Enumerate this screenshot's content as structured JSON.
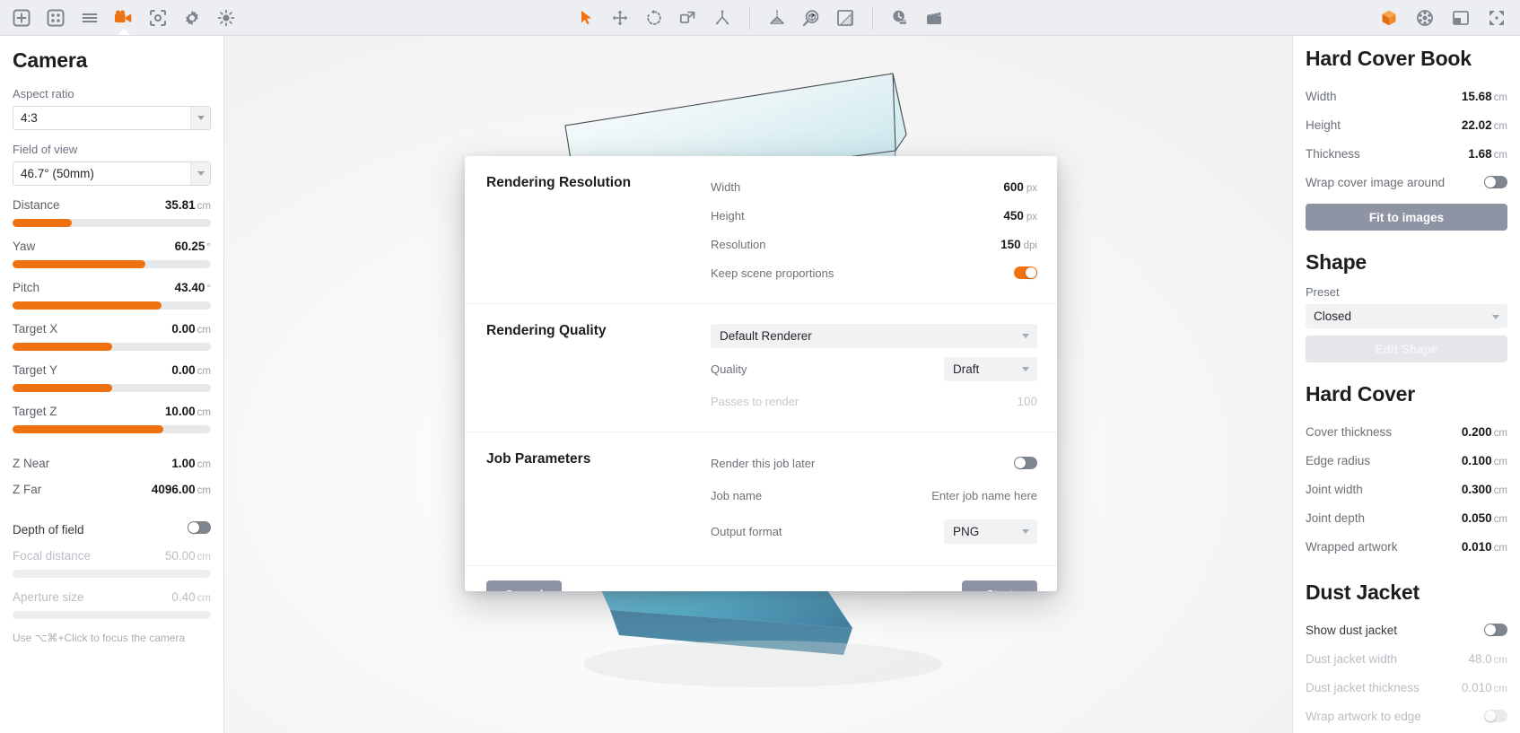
{
  "toolbar": {
    "left_icons": [
      {
        "name": "add-icon",
        "label": "Add"
      },
      {
        "name": "grid-icon",
        "label": "Layouts"
      },
      {
        "name": "list-icon",
        "label": "List"
      },
      {
        "name": "camera-icon",
        "label": "Camera"
      },
      {
        "name": "snapshot-icon",
        "label": "Snapshot"
      },
      {
        "name": "settings-gear-icon",
        "label": "Settings"
      },
      {
        "name": "light-bulb-icon",
        "label": "Lighting"
      }
    ],
    "center_icons": [
      {
        "name": "select-cursor-icon",
        "label": "Select"
      },
      {
        "name": "move-icon",
        "label": "Move"
      },
      {
        "name": "rotate-icon",
        "label": "Rotate"
      },
      {
        "name": "scale-icon",
        "label": "Scale"
      },
      {
        "name": "distribute-icon",
        "label": "Distribute"
      },
      {
        "name": "perspective-icon",
        "label": "Perspective"
      },
      {
        "name": "inspect-object-icon",
        "label": "Inspect"
      },
      {
        "name": "shading-icon",
        "label": "Shading"
      },
      {
        "name": "render-time-icon",
        "label": "Render"
      },
      {
        "name": "animation-clapboard-icon",
        "label": "Animation"
      }
    ],
    "right_icons": [
      {
        "name": "cube-3d-icon",
        "label": "3D View"
      },
      {
        "name": "sphere-wire-icon",
        "label": "Environment"
      },
      {
        "name": "panel-toggle-icon",
        "label": "Toggle Panel"
      },
      {
        "name": "fullscreen-icon",
        "label": "Fullscreen"
      }
    ],
    "accent_color": "#ef7110",
    "icon_color": "#7d858f",
    "background_color": "#eceef1"
  },
  "left_panel": {
    "title": "Camera",
    "aspect_ratio": {
      "label": "Aspect ratio",
      "value": "4:3"
    },
    "field_of_view": {
      "label": "Field of view",
      "value": "46.7° (50mm)"
    },
    "sliders": [
      {
        "label": "Distance",
        "value": "35.81",
        "unit": "cm",
        "percent": 30
      },
      {
        "label": "Yaw",
        "value": "60.25",
        "unit": "°",
        "percent": 67
      },
      {
        "label": "Pitch",
        "value": "43.40",
        "unit": "°",
        "percent": 75
      },
      {
        "label": "Target X",
        "value": "0.00",
        "unit": "cm",
        "percent": 50
      },
      {
        "label": "Target Y",
        "value": "0.00",
        "unit": "cm",
        "percent": 50
      },
      {
        "label": "Target Z",
        "value": "10.00",
        "unit": "cm",
        "percent": 76
      }
    ],
    "z_near": {
      "label": "Z Near",
      "value": "1.00",
      "unit": "cm"
    },
    "z_far": {
      "label": "Z Far",
      "value": "4096.00",
      "unit": "cm"
    },
    "depth_of_field": {
      "label": "Depth of field",
      "enabled": false
    },
    "focal_distance": {
      "label": "Focal distance",
      "value": "50.00",
      "unit": "cm",
      "percent": 0,
      "disabled": true
    },
    "aperture_size": {
      "label": "Aperture size",
      "value": "0.40",
      "unit": "cm",
      "percent": 0,
      "disabled": true
    },
    "hint": "Use ⌥⌘+Click to focus the camera"
  },
  "modal": {
    "sections": [
      {
        "title": "Rendering Resolution",
        "rows": [
          {
            "type": "value",
            "label": "Width",
            "value": "600",
            "unit": "px"
          },
          {
            "type": "value",
            "label": "Height",
            "value": "450",
            "unit": "px"
          },
          {
            "type": "value",
            "label": "Resolution",
            "value": "150",
            "unit": "dpi"
          },
          {
            "type": "toggle",
            "label": "Keep scene proportions",
            "enabled": true
          }
        ]
      },
      {
        "title": "Rendering Quality",
        "rows": [
          {
            "type": "select-full",
            "value": "Default Renderer"
          },
          {
            "type": "select-small",
            "label": "Quality",
            "value": "Draft"
          },
          {
            "type": "value-dim",
            "label": "Passes to render",
            "value": "100",
            "unit": ""
          }
        ]
      },
      {
        "title": "Job Parameters",
        "rows": [
          {
            "type": "toggle",
            "label": "Render this job later",
            "enabled": false
          },
          {
            "type": "input",
            "label": "Job name",
            "value": "",
            "placeholder": "Enter job name here"
          },
          {
            "type": "select-small",
            "label": "Output format",
            "value": "PNG"
          }
        ]
      }
    ],
    "cancel_label": "Cancel",
    "start_label": "Start"
  },
  "right_panel": {
    "book": {
      "title": "Hard Cover Book",
      "rows": [
        {
          "label": "Width",
          "value": "15.68",
          "unit": "cm"
        },
        {
          "label": "Height",
          "value": "22.02",
          "unit": "cm"
        },
        {
          "label": "Thickness",
          "value": "1.68",
          "unit": "cm"
        }
      ],
      "wrap_toggle": {
        "label": "Wrap cover image around",
        "enabled": false
      },
      "fit_button": "Fit to images"
    },
    "shape": {
      "title": "Shape",
      "preset_label": "Preset",
      "preset_value": "Closed",
      "edit_button": "Edit Shape"
    },
    "hard_cover": {
      "title": "Hard Cover",
      "rows": [
        {
          "label": "Cover thickness",
          "value": "0.200",
          "unit": "cm"
        },
        {
          "label": "Edge radius",
          "value": "0.100",
          "unit": "cm"
        },
        {
          "label": "Joint width",
          "value": "0.300",
          "unit": "cm"
        },
        {
          "label": "Joint depth",
          "value": "0.050",
          "unit": "cm"
        },
        {
          "label": "Wrapped artwork",
          "value": "0.010",
          "unit": "cm"
        }
      ]
    },
    "dust_jacket": {
      "title": "Dust Jacket",
      "show_toggle": {
        "label": "Show dust jacket",
        "enabled": false
      },
      "rows": [
        {
          "label": "Dust jacket width",
          "value": "48.0",
          "unit": "cm"
        },
        {
          "label": "Dust jacket thickness",
          "value": "0.010",
          "unit": "cm"
        }
      ],
      "wrap_edge": {
        "label": "Wrap artwork to edge",
        "enabled": false
      }
    }
  }
}
